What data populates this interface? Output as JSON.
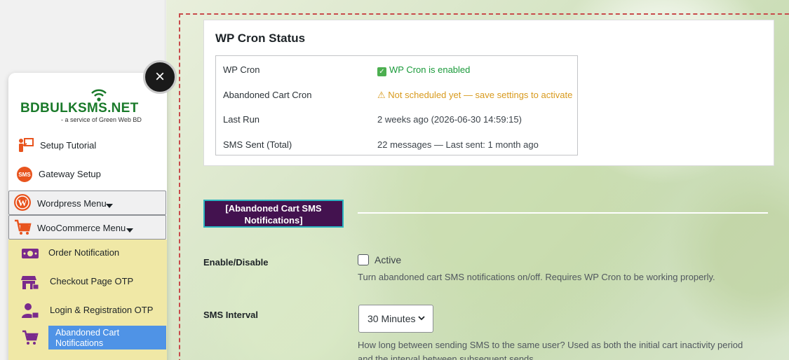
{
  "cron_status": {
    "title": "WP Cron Status",
    "rows": [
      {
        "key": "WP Cron",
        "value": "WP Cron is enabled"
      },
      {
        "key": "Abandoned Cart Cron",
        "value": "⚠ Not scheduled yet — save settings to activate"
      },
      {
        "key": "Last Run",
        "value": "2 weeks ago (2026-06-30 14:59:15)"
      },
      {
        "key": "SMS Sent (Total)",
        "value": "22 messages — Last sent: 1 month ago"
      }
    ]
  },
  "section": {
    "heading": "[Abandoned Cart SMS Notifications]"
  },
  "form": {
    "enable_label": "Enable/Disable",
    "active_text": "Active",
    "active_checked": false,
    "enable_desc": "Turn abandoned cart SMS notifications on/off. Requires WP Cron to be working properly.",
    "interval_label": "SMS Interval",
    "interval_value": "30 Minutes",
    "interval_desc": "How long between sending SMS to the same user? Used as both the initial cart inactivity period and the interval between subsequent sends."
  },
  "menu": {
    "logo_main": "BDBULKSMS.NET",
    "logo_sub": "- a service of Green Web BD",
    "close_label": "×",
    "items": [
      {
        "label": "Setup Tutorial"
      },
      {
        "label": "Gateway Setup"
      }
    ],
    "toggles": [
      {
        "label": "Wordpress Menu"
      },
      {
        "label": "WooCommerce Menu"
      }
    ],
    "submenu": [
      {
        "label": "Order Notification"
      },
      {
        "label": "Checkout Page OTP"
      },
      {
        "label": "Login & Registration OTP"
      },
      {
        "label": "Abandoned Cart Notifications"
      }
    ]
  },
  "colors": {
    "brand_green": "#1a7a2a",
    "section_bg": "#43124f",
    "section_border": "#2ab3c0",
    "submenu_bg": "#f0e8a6",
    "active_submenu": "#4f93e6",
    "ok_green": "#1a9a3a",
    "warn_orange": "#d89a1d",
    "dashed_red": "#c84a4a"
  }
}
